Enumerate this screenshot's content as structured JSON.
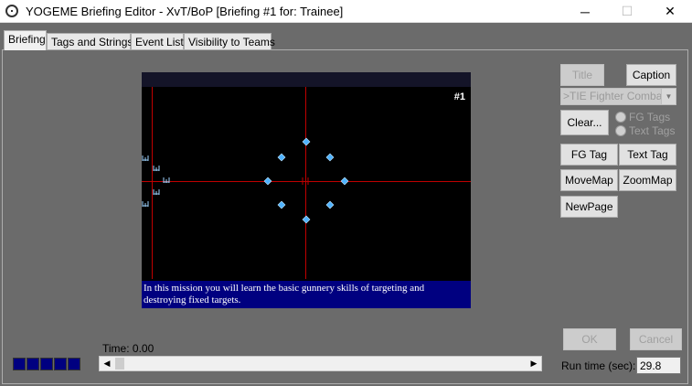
{
  "window": {
    "title": "YOGEME Briefing Editor - XvT/BoP   [Briefing #1 for: Trainee]",
    "minimize_glyph": "─",
    "maximize_glyph": "☐",
    "close_glyph": "✕"
  },
  "tabs": [
    {
      "label": "Briefing",
      "active": true
    },
    {
      "label": "Tags and Strings",
      "active": false
    },
    {
      "label": "Event List",
      "active": false
    },
    {
      "label": "Visibility to Teams",
      "active": false
    }
  ],
  "map": {
    "page_marker": "#1",
    "caption": "In this mission you will learn the basic gunnery skills of targeting and destroying fixed targets."
  },
  "controls": {
    "title_button": "Title",
    "caption_button": "Caption",
    "fg_combo_value": ">TIE Fighter Combat #",
    "clear_button": "Clear...",
    "fg_tags_radio": "FG Tags",
    "text_tags_radio": "Text Tags",
    "fg_tag_button": "FG Tag",
    "text_tag_button": "Text Tag",
    "movemap_button": "MoveMap",
    "zoommap_button": "ZoomMap",
    "newpage_button": "NewPage",
    "ok_button": "OK",
    "cancel_button": "Cancel"
  },
  "timeline": {
    "time_label": "Time: 0.00",
    "scroll_left": "◀",
    "scroll_right": "▶",
    "position_fraction": 0.0
  },
  "runtime": {
    "label": "Run time (sec):",
    "value": "29.8"
  },
  "colors": {
    "background": "#6b6b6b",
    "map_background": "#000000",
    "grid_line": "#c00000",
    "caption_background": "#000080",
    "marker": "#4fb3ff"
  },
  "icons": {
    "diamond_markers": "target-diamond-icon",
    "craft_markers": "fighter-craft-icon"
  }
}
